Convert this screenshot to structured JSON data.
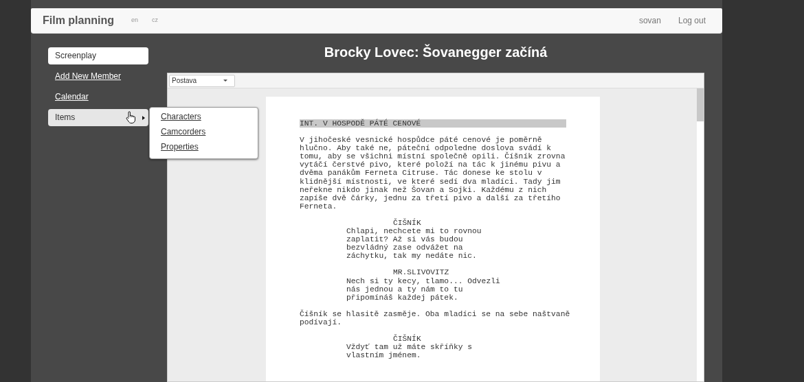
{
  "header": {
    "brand": "Film planning",
    "languages": [
      "en",
      "cz"
    ],
    "user": "sovan",
    "logout": "Log out"
  },
  "sidebar": {
    "items": [
      {
        "label": "Screenplay",
        "selected": true,
        "expanded": false
      },
      {
        "label": "Add New Member",
        "selected": false,
        "expanded": false
      },
      {
        "label": "Calendar",
        "selected": false,
        "expanded": false
      },
      {
        "label": "Items",
        "selected": false,
        "expanded": true,
        "children": [
          {
            "label": "Characters"
          },
          {
            "label": "Camcorders"
          },
          {
            "label": "Properties"
          }
        ]
      }
    ]
  },
  "title": "Brocky Lovec: Šovanegger začíná",
  "editor": {
    "toolbar": {
      "element_type": "Postava"
    },
    "blocks": [
      {
        "kind": "scene",
        "lines": [
          "INT. V HOSPODĚ PÁTÉ CENOVÉ"
        ]
      },
      {
        "kind": "action",
        "lines": [
          "V jihočeské vesnické hospůdce páté cenové je poměrně",
          "hlučno. Aby také ne, páteční odpoledne doslova svádí k",
          "tomu, aby se všichni místní společně opili. Číšník zrovna",
          "vytáčí čerstvé pivo, které položí na tác k jinému pivu a",
          "dvěma panákům Ferneta Citruse. Tác donese ke stolu v",
          "klidnější místnosti, ve které sedí dva mladíci. Tady jim",
          "neřekne nikdo jinak než Šovan a Sojki. Každému z nich",
          "zapíše dvě čárky, jednu za třetí pivo a další za třetího",
          "Ferneta."
        ]
      },
      {
        "kind": "character",
        "lines": [
          "ČIŠNÍK"
        ]
      },
      {
        "kind": "dialogue",
        "lines": [
          "Chlapi, nechcete mi to rovnou",
          "zaplatit? Až si vás budou",
          "bezvládný zase odvážet na",
          "záchytku, tak my nedáte nic."
        ]
      },
      {
        "kind": "character",
        "lines": [
          "MR.SLIVOVITZ"
        ]
      },
      {
        "kind": "dialogue",
        "lines": [
          "Nech si ty kecy, tlamo... Odvezli",
          "nás jednou a ty nám to tu",
          "připomínáš každej pátek."
        ]
      },
      {
        "kind": "action",
        "lines": [
          "Číšník se hlasitě zasměje. Oba mladíci se na sebe naštvaně",
          "podívají."
        ]
      },
      {
        "kind": "character",
        "lines": [
          "ČIŠNÍK"
        ]
      },
      {
        "kind": "dialogue",
        "lines": [
          "Vždyť tam už máte skříňky s",
          "vlastním jménem."
        ]
      }
    ]
  }
}
